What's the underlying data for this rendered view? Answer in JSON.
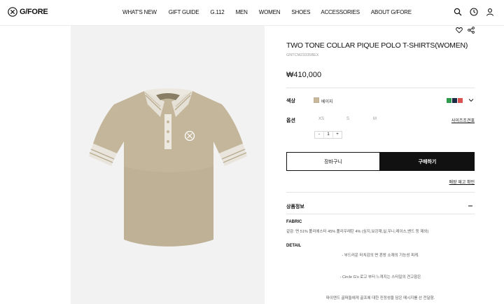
{
  "header": {
    "brand": "G/FORE",
    "nav": [
      "WHAT'S NEW",
      "GIFT GUIDE",
      "G.112",
      "MEN",
      "WOMEN",
      "SHOES",
      "ACCESSORIES",
      "ABOUT G/FORE"
    ],
    "icons": [
      "search-icon",
      "clock-icon",
      "user-icon"
    ]
  },
  "product": {
    "title": "TWO TONE COLLAR PIQUE POLO T-SHIRTS(WOMEN)",
    "sku": "GNTCM23335BEX",
    "price": "₩410,000",
    "color_label": "색상",
    "color_value": "베이지",
    "color_swatch": "#c9b99a",
    "other_colors": [
      "#2f9b4e",
      "#1d2a44",
      "#d9534f"
    ],
    "option_label": "옵션",
    "sizes": [
      "XS",
      "S",
      "M"
    ],
    "size_guide": "사이즈조견표",
    "qty": {
      "minus": "-",
      "value": "1",
      "plus": "+"
    },
    "cart_button": "장바구니",
    "buy_button": "구매하기",
    "stock_link": "매장 재고 확인"
  },
  "info": {
    "heading": "상품정보",
    "toggle": "—",
    "fabric_title": "FABRIC",
    "fabric_text": "겉감: 면 51% 폴리에스터 45% 폴리우레탄 4% (심지,보강재,실,우니,레이스,밴드 등 제외)",
    "detail_title": "DETAIL",
    "detail_lines": [
      "- 부드러운 터치감의 면 혼방 소재의 기능성 피케.",
      "- Circle G's 로고 부터 느껴지는 스타일의 견고함은",
      "파이엔드 골퍼들에게 골프에 대한 진정성을 담은 메시지를 선 전달함."
    ]
  }
}
